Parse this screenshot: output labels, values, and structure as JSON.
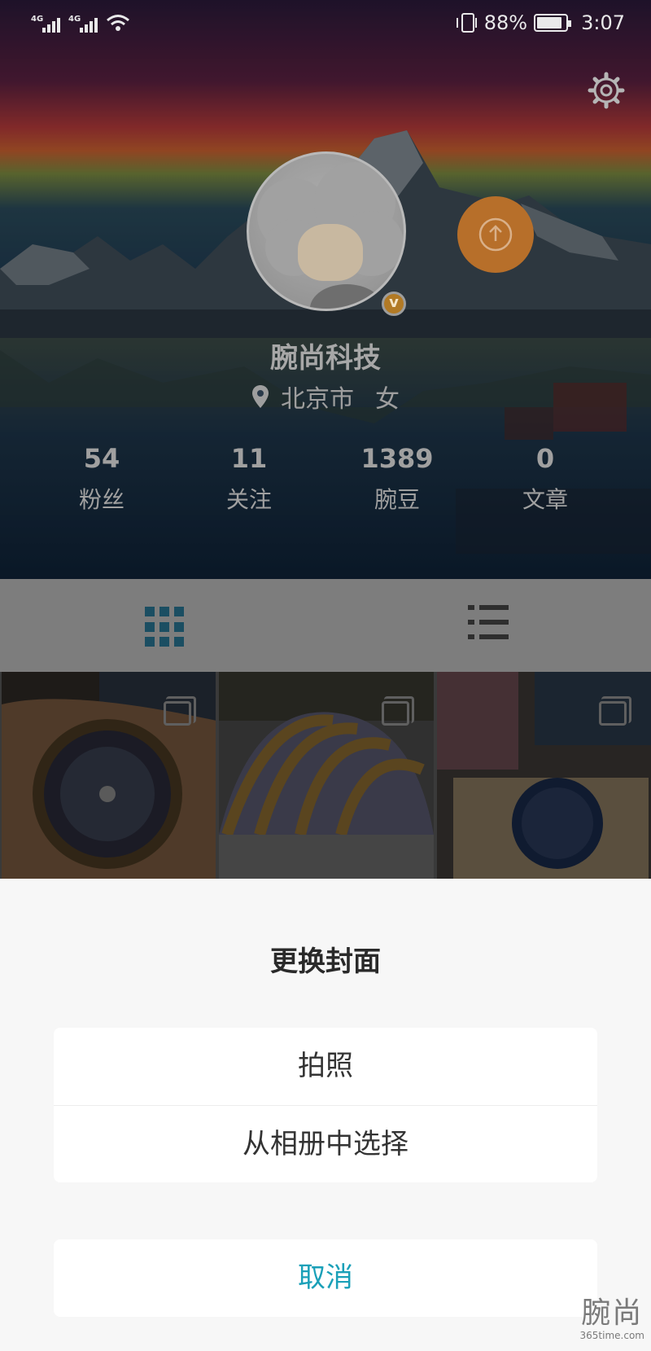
{
  "status_bar": {
    "network1": "4G",
    "network2": "4G",
    "battery_percent": "88%",
    "battery_level": 0.88,
    "time": "3:07"
  },
  "profile": {
    "name": "腕尚科技",
    "city": "北京市",
    "gender": "女",
    "verified_badge": "v",
    "stats": [
      {
        "value": "54",
        "label": "粉丝"
      },
      {
        "value": "11",
        "label": "关注"
      },
      {
        "value": "1389",
        "label": "腕豆"
      },
      {
        "value": "0",
        "label": "文章"
      }
    ]
  },
  "icons": {
    "settings": "gear-icon",
    "upload": "upload-icon",
    "location": "location-pin-icon",
    "grid_view": "grid-icon",
    "list_view": "list-icon",
    "multi_photo": "stack-icon"
  },
  "colors": {
    "accent": "#1aa0b8",
    "upload_button": "#b76f2a",
    "badge": "#b27a25",
    "grid_tab_active": "#1b4e62"
  },
  "sheet": {
    "title": "更换封面",
    "options": [
      "拍照",
      "从相册中选择"
    ],
    "cancel": "取消"
  },
  "watermark": {
    "brand": "腕尚",
    "site": "365time.com"
  }
}
